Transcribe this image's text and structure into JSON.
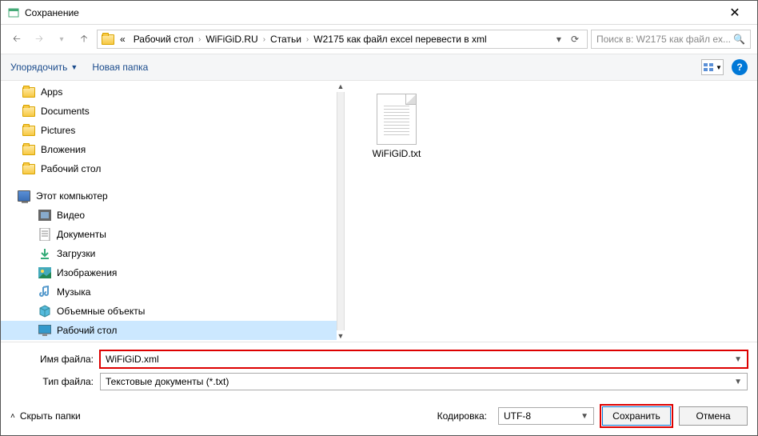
{
  "window": {
    "title": "Сохранение"
  },
  "breadcrumb": {
    "prefix": "«",
    "items": [
      "Рабочий стол",
      "WiFiGiD.RU",
      "Статьи",
      "W2175 как файл excel перевести в xml"
    ]
  },
  "search": {
    "placeholder": "Поиск в: W2175 как файл ex..."
  },
  "toolbar": {
    "organize": "Упорядочить",
    "new_folder": "Новая папка"
  },
  "tree": {
    "quick": [
      {
        "label": "Apps"
      },
      {
        "label": "Documents"
      },
      {
        "label": "Pictures"
      },
      {
        "label": "Вложения"
      },
      {
        "label": "Рабочий стол"
      }
    ],
    "pc_label": "Этот компьютер",
    "pc": [
      {
        "label": "Видео",
        "icon": "video"
      },
      {
        "label": "Документы",
        "icon": "doc"
      },
      {
        "label": "Загрузки",
        "icon": "download"
      },
      {
        "label": "Изображения",
        "icon": "image"
      },
      {
        "label": "Музыка",
        "icon": "music"
      },
      {
        "label": "Объемные объекты",
        "icon": "3d"
      },
      {
        "label": "Рабочий стол",
        "icon": "desktop",
        "selected": true
      }
    ]
  },
  "content": {
    "file_name": "WiFiGiD.txt"
  },
  "form": {
    "name_label": "Имя файла:",
    "name_value": "WiFiGiD.xml",
    "type_label": "Тип файла:",
    "type_value": "Текстовые документы (*.txt)"
  },
  "footer": {
    "hide": "Скрыть папки",
    "encoding_label": "Кодировка:",
    "encoding_value": "UTF-8",
    "save": "Сохранить",
    "cancel": "Отмена"
  }
}
